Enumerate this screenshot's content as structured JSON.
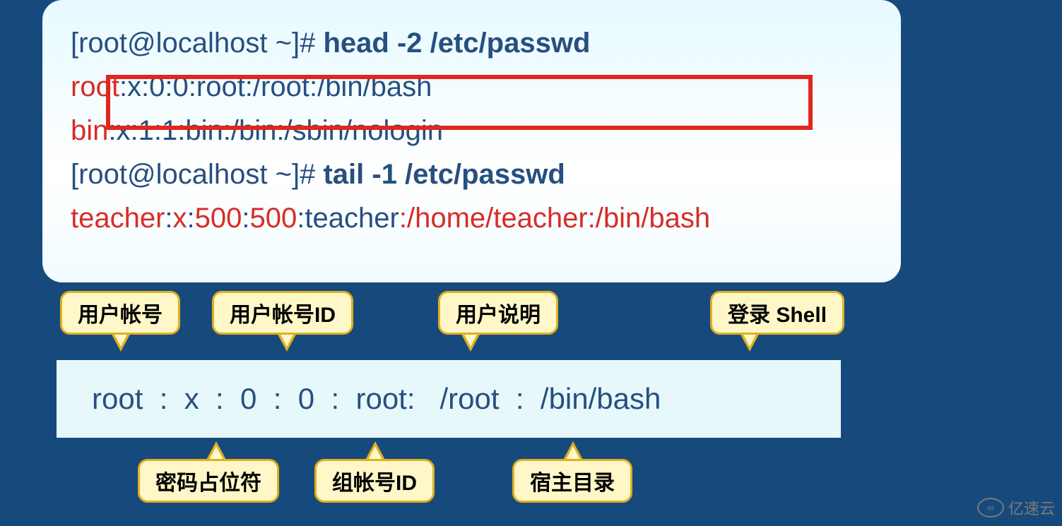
{
  "terminal": {
    "prompt1_pre": "[root@localhost ~]# ",
    "cmd1": "head -2 /etc/passwd",
    "line_root_user": "root",
    "line_root_rest": ":x:0:0:root:/root:/bin/bash",
    "line_bin_user": "bin",
    "line_bin_rest": ":x:1:1:bin:/bin:/sbin/nologin",
    "prompt2_pre": "[root@localhost ~]# ",
    "cmd2": "tail -1 /etc/passwd",
    "line_teacher_p1": "teacher",
    "line_teacher_p2": ":",
    "line_teacher_p3": "x",
    "line_teacher_p4": ":",
    "line_teacher_p5": "500",
    "line_teacher_p6": ":",
    "line_teacher_p7": "500",
    "line_teacher_p8": ":",
    "line_teacher_p9": "teacher",
    "line_teacher_p10": ":",
    "line_teacher_p11": "/home/teacher",
    "line_teacher_p12": ":",
    "line_teacher_p13": "/bin/bash"
  },
  "labels": {
    "user_account": "用户帐号",
    "user_account_id": "用户帐号ID",
    "user_desc": "用户说明",
    "login_shell": "登录 Shell",
    "password_placeholder": "密码占位符",
    "group_account_id": "组帐号ID",
    "home_dir": "宿主目录"
  },
  "breakdown": "root  :  x  :  0  :  0  :  root:   /root  :  /bin/bash",
  "watermark": "亿速云"
}
